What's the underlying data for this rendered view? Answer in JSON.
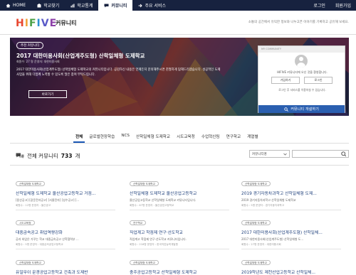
{
  "topnav": {
    "tabs": [
      {
        "label": "HOME",
        "icon": "home-icon"
      },
      {
        "label": "학교찾기",
        "icon": "school-icon"
      },
      {
        "label": "학교통계",
        "icon": "chart-icon"
      },
      {
        "label": "커뮤니티",
        "icon": "chat-icon"
      },
      {
        "label": "주요 서비스",
        "icon": "arrow-icon"
      }
    ],
    "login": "로그인",
    "signup": "회원가입",
    "active_index": 3
  },
  "header": {
    "logo": "HIFIVE",
    "title": "커뮤니티",
    "tagline": "소통의 공간에서 유익한 정보와 나누고픈 이야기를 기록하고 공유해 보세요."
  },
  "hero": {
    "badge": "추천 커뮤니티",
    "title": "2017 대한미용사회(산업계주도형) 산학일체형 도제학교",
    "meta": "회원수: 27 명 운영자: 대한미용사회",
    "description": "2017 대한미용사회(산업계주도형) 산학일체형 도제학교의 커뮤니티입니다. 공감하신 내용은 언제든지 문의해주시면 친절하게 답해드리겠습니다. 성공적인 도제사업을 위해 다함께 노력할 수 있도록 많은 참여 부탁드립니다.",
    "button": "바로가기"
  },
  "login_card": {
    "header": "MY COMMUNITY",
    "welcome": "HIFIVE 커뮤니티에 오신 것을 환영합니다.",
    "signup_button": "가입하기",
    "login_button": "로그인",
    "note": "로그인 후 서비스를 이용하실 수 있습니다.",
    "create_button": "커뮤니티 개설하기"
  },
  "category_tabs": [
    "전체",
    "글로벌현장학습",
    "NCS",
    "산학일체형 도제학교",
    "시도교육청",
    "수업혁신팀",
    "연구학교",
    "계열별"
  ],
  "active_category": 0,
  "listing": {
    "label_prefix": "전체 커뮤니티",
    "count": "733",
    "label_suffix": "개",
    "select_value": "커뮤니티명",
    "search_placeholder": ""
  },
  "cards": [
    {
      "tag": "산학일체형 도제학교",
      "title": "산학일체형 도제학교 울산공업고등학교 거점...",
      "sub": "[용산공고] [광운전자공고] [서울전자] [성수공고] [...",
      "meta": "회원수 : 12명 운영자 : 울산공고"
    },
    {
      "tag": "산학일체형 도제학교",
      "title": "산학일체형 도제학교 울산공업고등학교",
      "sub": "울산공업고등학교 산학일체형 도제학교 커뮤니티입니다.",
      "meta": "회원수 : 67명 운영자 : 울산공업고등학교"
    },
    {
      "tag": "산학일체형 도제학교",
      "title": "2019 경기자동차과학고 산학일체형 도제...",
      "sub": "2019 경기자동차과학고 산학일체형 도제학교",
      "meta": "회원수 : 5명 운영자 : 경기자동차과학고"
    },
    {
      "tag": "시도교육청",
      "title": "대중금속공고 취업역량강화",
      "sub": "공과 외업은 가꾸는 학교 대중금속공고 산학협력부 ...",
      "meta": "회원수 : 5명 운영자 : 대중금속공업고등학교"
    },
    {
      "tag": "연구학교",
      "title": "직업계고 학점제 연구·선도학교",
      "sub": "직업계고 학점제 연구·선도학교 커뮤니티입니다.",
      "meta": "회원수 : 218명 운영자 : 한국직업능력개발원"
    },
    {
      "tag": "산학일체형 도제학교",
      "title": "2017 대한미용사회(산업계주도형) 산학일체...",
      "sub": "2017 대한미용사회(산업계주도형) 산학일체형 도...",
      "meta": "회원수 : 27명 운영자 : 대한미용사회"
    },
    {
      "tag": "산학일체형 도제학교",
      "title": "유일무이 문경공업고등학교 건축과 도제반",
      "sub": "",
      "meta": ""
    },
    {
      "tag": "산학일체형 도제학교",
      "title": "충주공업고등학교 산학일체형 도제학교",
      "sub": "",
      "meta": ""
    },
    {
      "tag": "산학일체형 도제학교",
      "title": "2019학년도 제천산업고등학교 산학일체...",
      "sub": "",
      "meta": ""
    }
  ]
}
